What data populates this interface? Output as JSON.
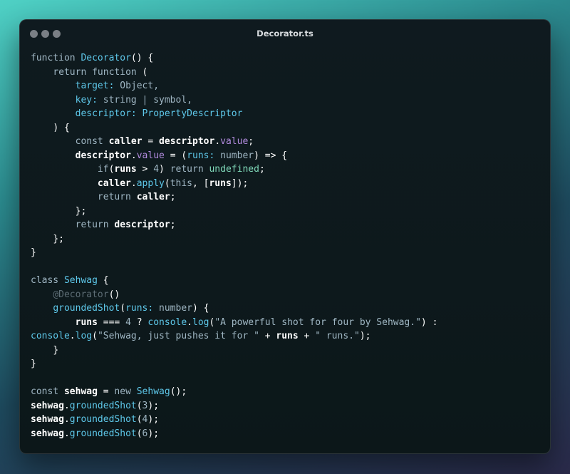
{
  "window": {
    "title": "Decorator.ts",
    "controls": [
      "close-dot",
      "minimize-dot",
      "maximize-dot"
    ]
  },
  "colors": {
    "keyword": "#9fb6c3",
    "function_name": "#5ec8ea",
    "identifier": "#ffffff",
    "property": "#b38ce0",
    "string": "#9fb6c3",
    "undefined": "#7fd8b8",
    "decorator": "#5e6e76",
    "background": "#0f1a1f"
  },
  "code": {
    "lines": [
      [
        {
          "t": "function",
          "c": "kw"
        },
        {
          "t": " "
        },
        {
          "t": "Decorator",
          "c": "fn"
        },
        {
          "t": "() {",
          "c": "pun"
        }
      ],
      [
        {
          "t": "    "
        },
        {
          "t": "return",
          "c": "kw"
        },
        {
          "t": " "
        },
        {
          "t": "function",
          "c": "kw"
        },
        {
          "t": " (",
          "c": "pun"
        }
      ],
      [
        {
          "t": "        "
        },
        {
          "t": "target:",
          "c": "prm"
        },
        {
          "t": " "
        },
        {
          "t": "Object,",
          "c": "type"
        }
      ],
      [
        {
          "t": "        "
        },
        {
          "t": "key:",
          "c": "prm"
        },
        {
          "t": " "
        },
        {
          "t": "string | symbol,",
          "c": "type"
        }
      ],
      [
        {
          "t": "        "
        },
        {
          "t": "descriptor:",
          "c": "prm"
        },
        {
          "t": " "
        },
        {
          "t": "PropertyDescriptor",
          "c": "ptype"
        }
      ],
      [
        {
          "t": "    "
        },
        {
          "t": ") {",
          "c": "pun"
        }
      ],
      [
        {
          "t": "        "
        },
        {
          "t": "const",
          "c": "kw"
        },
        {
          "t": " "
        },
        {
          "t": "caller",
          "c": "var"
        },
        {
          "t": " = ",
          "c": "op"
        },
        {
          "t": "descriptor",
          "c": "var"
        },
        {
          "t": ".",
          "c": "pun"
        },
        {
          "t": "value",
          "c": "prop"
        },
        {
          "t": ";",
          "c": "pun"
        }
      ],
      [
        {
          "t": "        "
        },
        {
          "t": "descriptor",
          "c": "var"
        },
        {
          "t": ".",
          "c": "pun"
        },
        {
          "t": "value",
          "c": "prop"
        },
        {
          "t": " = (",
          "c": "op"
        },
        {
          "t": "runs:",
          "c": "prm"
        },
        {
          "t": " "
        },
        {
          "t": "number",
          "c": "type"
        },
        {
          "t": ") => {",
          "c": "pun"
        }
      ],
      [
        {
          "t": "            "
        },
        {
          "t": "if",
          "c": "kw"
        },
        {
          "t": "(",
          "c": "pun"
        },
        {
          "t": "runs",
          "c": "var"
        },
        {
          "t": " > ",
          "c": "op"
        },
        {
          "t": "4",
          "c": "num"
        },
        {
          "t": ") ",
          "c": "pun"
        },
        {
          "t": "return",
          "c": "kw"
        },
        {
          "t": " "
        },
        {
          "t": "undefined",
          "c": "und"
        },
        {
          "t": ";",
          "c": "pun"
        }
      ],
      [
        {
          "t": "            "
        },
        {
          "t": "caller",
          "c": "var"
        },
        {
          "t": ".",
          "c": "pun"
        },
        {
          "t": "apply",
          "c": "fn"
        },
        {
          "t": "(",
          "c": "pun"
        },
        {
          "t": "this",
          "c": "kw"
        },
        {
          "t": ", [",
          "c": "pun"
        },
        {
          "t": "runs",
          "c": "var"
        },
        {
          "t": "]);",
          "c": "pun"
        }
      ],
      [
        {
          "t": "            "
        },
        {
          "t": "return",
          "c": "kw"
        },
        {
          "t": " "
        },
        {
          "t": "caller",
          "c": "var"
        },
        {
          "t": ";",
          "c": "pun"
        }
      ],
      [
        {
          "t": "        "
        },
        {
          "t": "};",
          "c": "pun"
        }
      ],
      [
        {
          "t": "        "
        },
        {
          "t": "return",
          "c": "kw"
        },
        {
          "t": " "
        },
        {
          "t": "descriptor",
          "c": "var"
        },
        {
          "t": ";",
          "c": "pun"
        }
      ],
      [
        {
          "t": "    "
        },
        {
          "t": "};",
          "c": "pun"
        }
      ],
      [
        {
          "t": "}",
          "c": "pun"
        }
      ],
      [],
      [
        {
          "t": "class",
          "c": "kw"
        },
        {
          "t": " "
        },
        {
          "t": "Sehwag",
          "c": "fn"
        },
        {
          "t": " {",
          "c": "pun"
        }
      ],
      [
        {
          "t": "    "
        },
        {
          "t": "@Decorator",
          "c": "dec"
        },
        {
          "t": "()",
          "c": "pun"
        }
      ],
      [
        {
          "t": "    "
        },
        {
          "t": "groundedShot",
          "c": "fn"
        },
        {
          "t": "(",
          "c": "pun"
        },
        {
          "t": "runs:",
          "c": "prm"
        },
        {
          "t": " "
        },
        {
          "t": "number",
          "c": "type"
        },
        {
          "t": ") {",
          "c": "pun"
        }
      ],
      [
        {
          "t": "        "
        },
        {
          "t": "runs",
          "c": "var"
        },
        {
          "t": " === ",
          "c": "op"
        },
        {
          "t": "4",
          "c": "num"
        },
        {
          "t": " ? ",
          "c": "op"
        },
        {
          "t": "console",
          "c": "fn"
        },
        {
          "t": ".",
          "c": "pun"
        },
        {
          "t": "log",
          "c": "fn"
        },
        {
          "t": "(",
          "c": "pun"
        },
        {
          "t": "\"A powerful shot for four by Sehwag.\"",
          "c": "str"
        },
        {
          "t": ") :",
          "c": "pun"
        }
      ],
      [
        {
          "t": "console",
          "c": "fn"
        },
        {
          "t": ".",
          "c": "pun"
        },
        {
          "t": "log",
          "c": "fn"
        },
        {
          "t": "(",
          "c": "pun"
        },
        {
          "t": "\"Sehwag, just pushes it for \"",
          "c": "str"
        },
        {
          "t": " + ",
          "c": "op"
        },
        {
          "t": "runs",
          "c": "var"
        },
        {
          "t": " + ",
          "c": "op"
        },
        {
          "t": "\" runs.\"",
          "c": "str"
        },
        {
          "t": ");",
          "c": "pun"
        }
      ],
      [
        {
          "t": "    "
        },
        {
          "t": "}",
          "c": "pun"
        }
      ],
      [
        {
          "t": "}",
          "c": "pun"
        }
      ],
      [],
      [
        {
          "t": "const",
          "c": "kw"
        },
        {
          "t": " "
        },
        {
          "t": "sehwag",
          "c": "var"
        },
        {
          "t": " = ",
          "c": "op"
        },
        {
          "t": "new",
          "c": "kw"
        },
        {
          "t": " "
        },
        {
          "t": "Sehwag",
          "c": "fn"
        },
        {
          "t": "();",
          "c": "pun"
        }
      ],
      [
        {
          "t": "sehwag",
          "c": "var"
        },
        {
          "t": ".",
          "c": "pun"
        },
        {
          "t": "groundedShot",
          "c": "fn"
        },
        {
          "t": "(",
          "c": "pun"
        },
        {
          "t": "3",
          "c": "num"
        },
        {
          "t": ");",
          "c": "pun"
        }
      ],
      [
        {
          "t": "sehwag",
          "c": "var"
        },
        {
          "t": ".",
          "c": "pun"
        },
        {
          "t": "groundedShot",
          "c": "fn"
        },
        {
          "t": "(",
          "c": "pun"
        },
        {
          "t": "4",
          "c": "num"
        },
        {
          "t": ");",
          "c": "pun"
        }
      ],
      [
        {
          "t": "sehwag",
          "c": "var"
        },
        {
          "t": ".",
          "c": "pun"
        },
        {
          "t": "groundedShot",
          "c": "fn"
        },
        {
          "t": "(",
          "c": "pun"
        },
        {
          "t": "6",
          "c": "num"
        },
        {
          "t": ");",
          "c": "pun"
        }
      ]
    ]
  }
}
